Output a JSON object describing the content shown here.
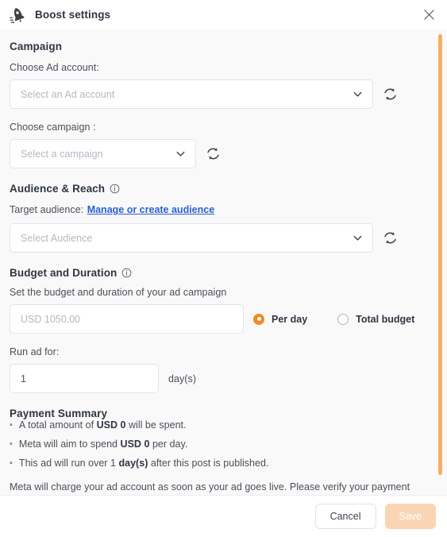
{
  "header": {
    "title": "Boost settings",
    "rocket_icon": "rocket-icon",
    "close_icon": "close-icon"
  },
  "campaign": {
    "section_title": "Campaign",
    "ad_account_label": "Choose Ad account:",
    "ad_account_placeholder": "Select an Ad account",
    "campaign_label": "Choose campaign :",
    "campaign_placeholder": "Select a campaign",
    "refresh_icon": "refresh-icon",
    "chevron_icon": "chevron-down-icon"
  },
  "audience": {
    "section_title": "Audience & Reach",
    "info_icon": "info-icon",
    "target_label": "Target audience:",
    "manage_link": "Manage or create audience",
    "audience_placeholder": "Select Audience"
  },
  "budget": {
    "section_title": "Budget and Duration",
    "info_icon": "info-icon",
    "description": "Set the budget and duration of your ad campaign",
    "amount_placeholder": "USD 1050.00",
    "amount_value": "",
    "options": [
      {
        "label": "Per day",
        "selected": true
      },
      {
        "label": "Total budget",
        "selected": false
      }
    ],
    "run_ad_label": "Run ad for:",
    "days_value": "1",
    "days_unit": "day(s)"
  },
  "payment_summary": {
    "section_title": "Payment Summary",
    "bullets": [
      {
        "pre": "A total amount of ",
        "bold": "USD 0",
        "post": " will be spent."
      },
      {
        "pre": "Meta will aim to spend ",
        "bold": "USD 0",
        "post": " per day."
      },
      {
        "pre": "This ad will run over 1 ",
        "bold": "day(s)",
        "post": " after this post is published."
      }
    ],
    "note": "Meta will charge your ad account as soon as your ad goes live. Please verify your payment"
  },
  "footer": {
    "cancel_label": "Cancel",
    "save_label": "Save"
  },
  "colors": {
    "accent": "#f08a24",
    "scrollbar": "#f5ae68",
    "link": "#2d5fd0",
    "save_disabled": "#fad5b5",
    "body_bg": "#f9f9f9"
  }
}
